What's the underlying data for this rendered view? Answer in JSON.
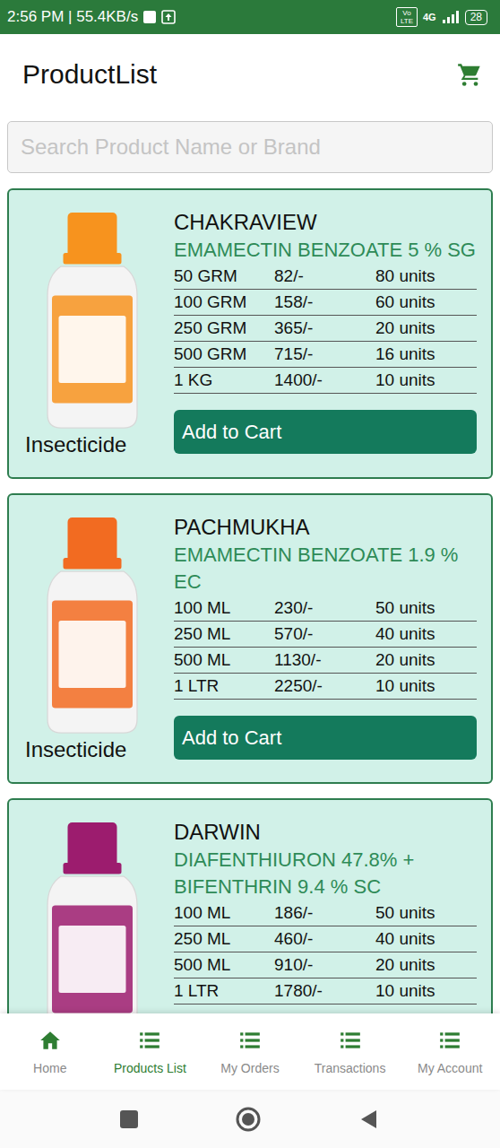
{
  "status_bar": {
    "time": "2:56 PM | 55.4KB/s",
    "volte": "Vo LTE",
    "network": "4G",
    "battery": "28"
  },
  "header": {
    "title": "ProductList"
  },
  "search": {
    "placeholder": "Search Product Name or Brand"
  },
  "products": [
    {
      "name": "CHAKRAVIEW",
      "technical": "EMAMECTIN BENZOATE 5 % SG",
      "category": "Insecticide",
      "button": "Add to Cart",
      "color": "#f7931e",
      "packs": [
        {
          "size": "50 GRM",
          "price": "82/-",
          "units": "80 units"
        },
        {
          "size": "100 GRM",
          "price": "158/-",
          "units": "60 units"
        },
        {
          "size": "250 GRM",
          "price": "365/-",
          "units": "20 units"
        },
        {
          "size": "500 GRM",
          "price": "715/-",
          "units": "16 units"
        },
        {
          "size": "1 KG",
          "price": "1400/-",
          "units": "10 units"
        }
      ]
    },
    {
      "name": "PACHMUKHA",
      "technical": "EMAMECTIN BENZOATE 1.9 % EC",
      "category": "Insecticide",
      "button": "Add to Cart",
      "color": "#f26b21",
      "packs": [
        {
          "size": "100 ML",
          "price": "230/-",
          "units": "50 units"
        },
        {
          "size": "250 ML",
          "price": "570/-",
          "units": "40 units"
        },
        {
          "size": "500 ML",
          "price": "1130/-",
          "units": "20 units"
        },
        {
          "size": "1 LTR",
          "price": "2250/-",
          "units": "10 units"
        }
      ]
    },
    {
      "name": "DARWIN",
      "technical": "DIAFENTHIURON 47.8% + BIFENTHRIN 9.4 % SC",
      "color": "#9c1c6e",
      "packs": [
        {
          "size": "100 ML",
          "price": "186/-",
          "units": "50 units"
        },
        {
          "size": "250 ML",
          "price": "460/-",
          "units": "40 units"
        },
        {
          "size": "500 ML",
          "price": "910/-",
          "units": "20 units"
        },
        {
          "size": "1 LTR",
          "price": "1780/-",
          "units": "10 units"
        }
      ]
    }
  ],
  "bottom_nav": [
    {
      "label": "Home",
      "kind": "home",
      "selected": false
    },
    {
      "label": "Products List",
      "kind": "list",
      "selected": true
    },
    {
      "label": "My Orders",
      "kind": "list",
      "selected": false
    },
    {
      "label": "Transactions",
      "kind": "list",
      "selected": false
    },
    {
      "label": "My Account",
      "kind": "list",
      "selected": false
    }
  ]
}
